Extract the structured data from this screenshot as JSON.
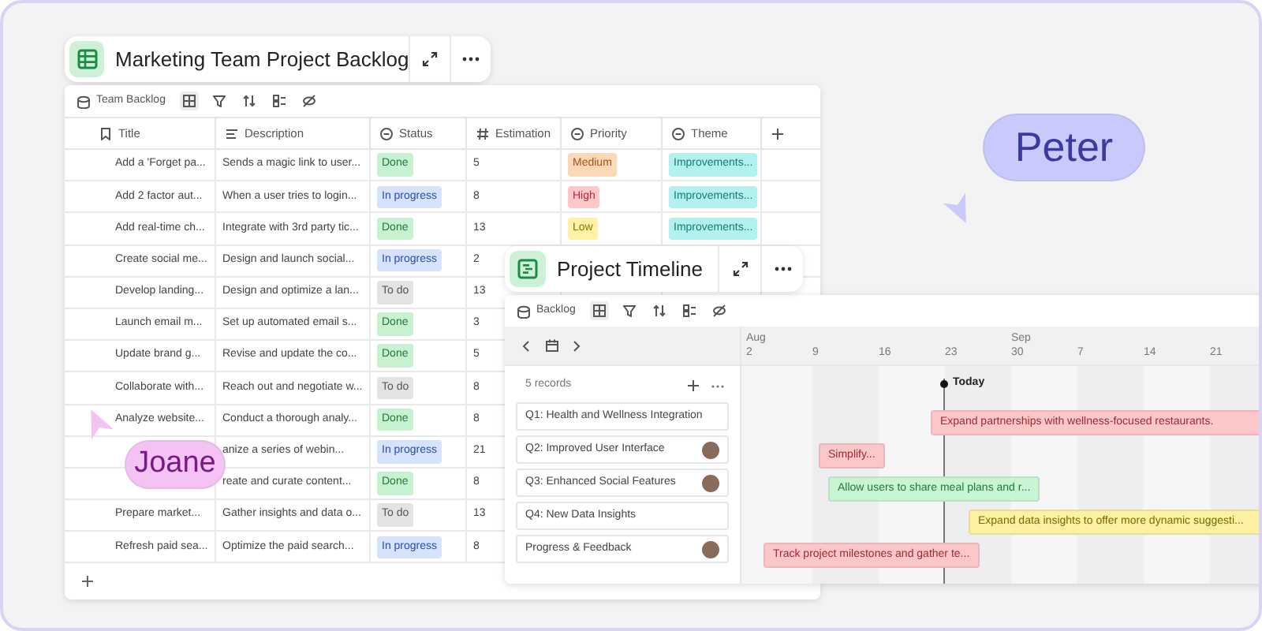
{
  "backlog": {
    "title": "Marketing Team Project Backlog",
    "view": "Team Backlog",
    "columns": [
      "Title",
      "Description",
      "Status",
      "Estimation",
      "Priority",
      "Theme"
    ],
    "rows": [
      {
        "title": "Add a 'Forget pa...",
        "description": "Sends a magic link to user...",
        "status": {
          "text": "Done",
          "color": "#c8f1d1"
        },
        "estimation": "5",
        "priority": {
          "text": "Medium",
          "color": "#fcd9b6"
        },
        "theme": {
          "text": "Improvements...",
          "color": "#b3f1ee"
        }
      },
      {
        "title": "Add 2 factor aut...",
        "description": "When a user tries to login...",
        "status": {
          "text": "In progress",
          "color": "#d5e3fd"
        },
        "estimation": "8",
        "priority": {
          "text": "High",
          "color": "#fcc8ca"
        },
        "theme": {
          "text": "Improvements...",
          "color": "#b3f1ee"
        }
      },
      {
        "title": "Add real-time ch...",
        "description": "Integrate with 3rd party tic...",
        "status": {
          "text": "Done",
          "color": "#c8f1d1"
        },
        "estimation": "13",
        "priority": {
          "text": "Low",
          "color": "#fdf2a6"
        },
        "theme": {
          "text": "Improvements...",
          "color": "#b3f1ee"
        }
      },
      {
        "title": "Create social me...",
        "description": "Design and launch social...",
        "status": {
          "text": "In progress",
          "color": "#d5e3fd"
        },
        "estimation": "2"
      },
      {
        "title": "Develop landing...",
        "description": "Design and optimize a lan...",
        "status": {
          "text": "To do",
          "color": "#e3e3e3"
        },
        "estimation": "13"
      },
      {
        "title": "Launch email m...",
        "description": "Set up automated email s...",
        "status": {
          "text": "Done",
          "color": "#c8f1d1"
        },
        "estimation": "3"
      },
      {
        "title": "Update brand g...",
        "description": "Revise and update the co...",
        "status": {
          "text": "Done",
          "color": "#c8f1d1"
        },
        "estimation": "5"
      },
      {
        "title": "Collaborate with...",
        "description": "Reach out and negotiate w...",
        "status": {
          "text": "To do",
          "color": "#e3e3e3"
        },
        "estimation": "8"
      },
      {
        "title": "Analyze website...",
        "description": "Conduct a thorough analy...",
        "status": {
          "text": "Done",
          "color": "#c8f1d1"
        },
        "estimation": "8"
      },
      {
        "description": "anize a series of webin...",
        "status": {
          "text": "In progress",
          "color": "#d5e3fd"
        },
        "estimation": "21"
      },
      {
        "description": "reate and curate content...",
        "status": {
          "text": "Done",
          "color": "#c8f1d1"
        },
        "estimation": "8"
      },
      {
        "title": "Prepare market...",
        "description": "Gather insights and data o...",
        "status": {
          "text": "To do",
          "color": "#e3e3e3"
        },
        "estimation": "13"
      },
      {
        "title": "Refresh paid sea...",
        "description": "Optimize the paid search...",
        "status": {
          "text": "In progress",
          "color": "#d5e3fd"
        },
        "estimation": "8"
      }
    ]
  },
  "timeline": {
    "title": "Project Timeline",
    "view": "Backlog",
    "record_count": "5 records",
    "months": [
      "Aug",
      "Sep"
    ],
    "weeks": [
      "2",
      "9",
      "16",
      "23",
      "30",
      "7",
      "14",
      "21"
    ],
    "today": "Today",
    "records": [
      {
        "label": "Q1: Health and Wellness Integration",
        "avatar": false
      },
      {
        "label": "Q2: Improved User Interface",
        "avatar": true
      },
      {
        "label": "Q3: Enhanced Social Features",
        "avatar": true
      },
      {
        "label": "Q4: New Data Insights",
        "avatar": false
      },
      {
        "label": "Progress & Feedback",
        "avatar": true
      }
    ],
    "bars": [
      {
        "text": "Expand partnerships with wellness-focused restaurants.",
        "color": "#fbc7c9"
      },
      {
        "text": "Simplify...",
        "color": "#fbc7c9"
      },
      {
        "text": "Allow users to share meal plans and r...",
        "color": "#c9f5d4"
      },
      {
        "text": "Expand data insights to offer more dynamic suggesti...",
        "color": "#fcf0a2"
      },
      {
        "text": "Track project milestones and gather te...",
        "color": "#fbc7c9"
      }
    ]
  },
  "cursors": [
    {
      "name": "Peter",
      "color": "#c9c9fb"
    },
    {
      "name": "Joane",
      "color": "#f4c3f4"
    }
  ]
}
